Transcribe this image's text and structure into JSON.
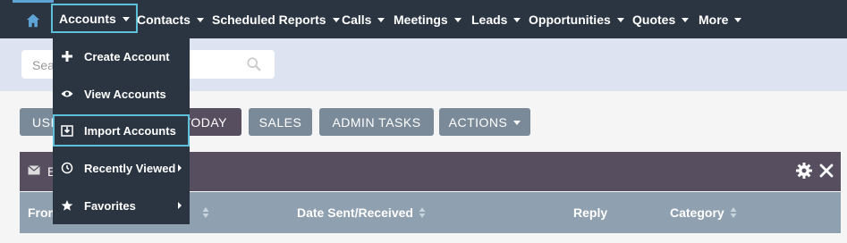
{
  "nav": {
    "home_icon": "home-icon",
    "items": [
      {
        "label": "Accounts"
      },
      {
        "label": "Contacts"
      },
      {
        "label": "Scheduled Reports"
      },
      {
        "label": "Calls"
      },
      {
        "label": "Meetings"
      },
      {
        "label": "Leads"
      },
      {
        "label": "Opportunities"
      },
      {
        "label": "Quotes"
      },
      {
        "label": "More"
      }
    ]
  },
  "search": {
    "placeholder": "Sea",
    "icon": "search-icon"
  },
  "dashboard_tabs": [
    {
      "label": "USI"
    },
    {
      "label": "TODAY"
    },
    {
      "label": "SALES"
    },
    {
      "label": "ADMIN TASKS"
    },
    {
      "label": "ACTIONS"
    }
  ],
  "dashlet": {
    "title": "E",
    "icons": [
      "mail-icon",
      "gear-icon",
      "close-icon"
    ]
  },
  "table": {
    "columns": [
      {
        "label": "From"
      },
      {
        "label": "Date Sent/Received"
      },
      {
        "label": "Reply"
      },
      {
        "label": "Category"
      }
    ]
  },
  "accounts_menu": {
    "items": [
      {
        "label": "Create Account",
        "icon": "plus-icon"
      },
      {
        "label": "View Accounts",
        "icon": "eye-icon"
      },
      {
        "label": "Import Accounts",
        "icon": "import-icon"
      },
      {
        "label": "Recently Viewed",
        "icon": "history-icon"
      },
      {
        "label": "Favorites",
        "icon": "star-icon"
      }
    ]
  },
  "colors": {
    "nav_bg": "#2b3441",
    "highlight": "#5ec0d8",
    "dashlet_bg": "#574f60",
    "button_bg": "#7a8a99",
    "table_header_bg": "#8fa0b0"
  }
}
